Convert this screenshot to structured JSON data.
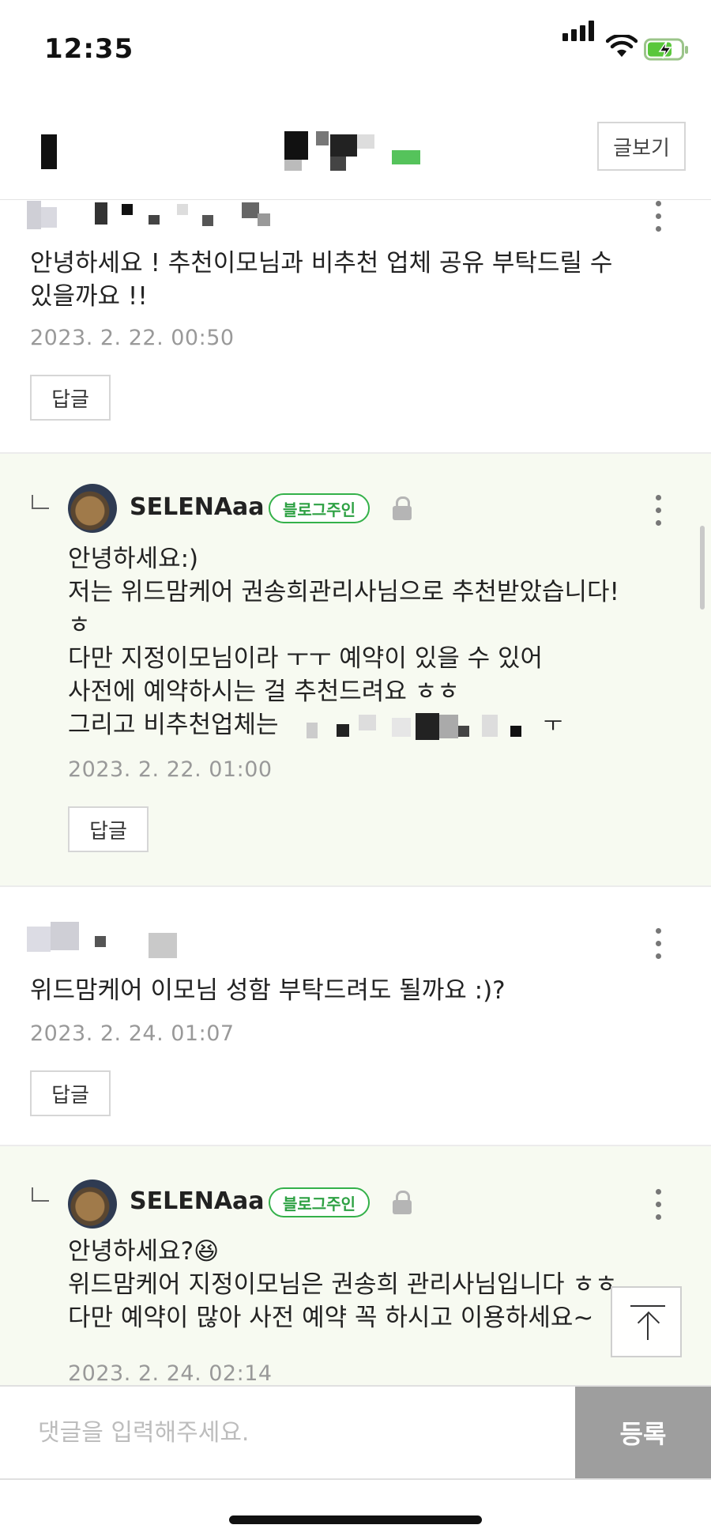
{
  "status": {
    "time": "12:35"
  },
  "nav": {
    "view_post": "글보기"
  },
  "comments": [
    {
      "text": "안녕하세요 ! 추천이모님과 비추천 업체 공유 부탁드릴 수\n있을까요 !!",
      "date": "2023. 2. 22. 00:50",
      "reply_label": "답글"
    },
    {
      "author": "SELENAaa",
      "badge": "블로그주인",
      "text": "안녕하세요:)\n저는 위드맘케어 권송희관리사님으로 추천받았습니다!\nㅎ\n다만 지정이모님이라 ㅜㅜ 예약이 있을 수 있어\n사전에 예약하시는 걸 추천드려요 ㅎㅎ\n그리고 비추천업체는",
      "text_tail": "ㅜ",
      "date": "2023. 2. 22. 01:00",
      "reply_label": "답글"
    },
    {
      "text": "위드맘케어 이모님 성함 부탁드려도 될까요 :)?",
      "date": "2023. 2. 24. 01:07",
      "reply_label": "답글"
    },
    {
      "author": "SELENAaa",
      "badge": "블로그주인",
      "text": "안녕하세요?😆\n위드맘케어 지정이모님은 권송희 관리사님입니다 ㅎㅎ\n다만 예약이 많아 사전 예약 꼭 하시고 이용하세요~",
      "date": "2023. 2. 24. 02:14"
    }
  ],
  "input": {
    "placeholder": "댓글을 입력해주세요.",
    "submit": "등록"
  },
  "colors": {
    "reply_bg": "#f7faf1",
    "badge_green": "#34b14a",
    "submit_bg": "#9e9e9e"
  }
}
